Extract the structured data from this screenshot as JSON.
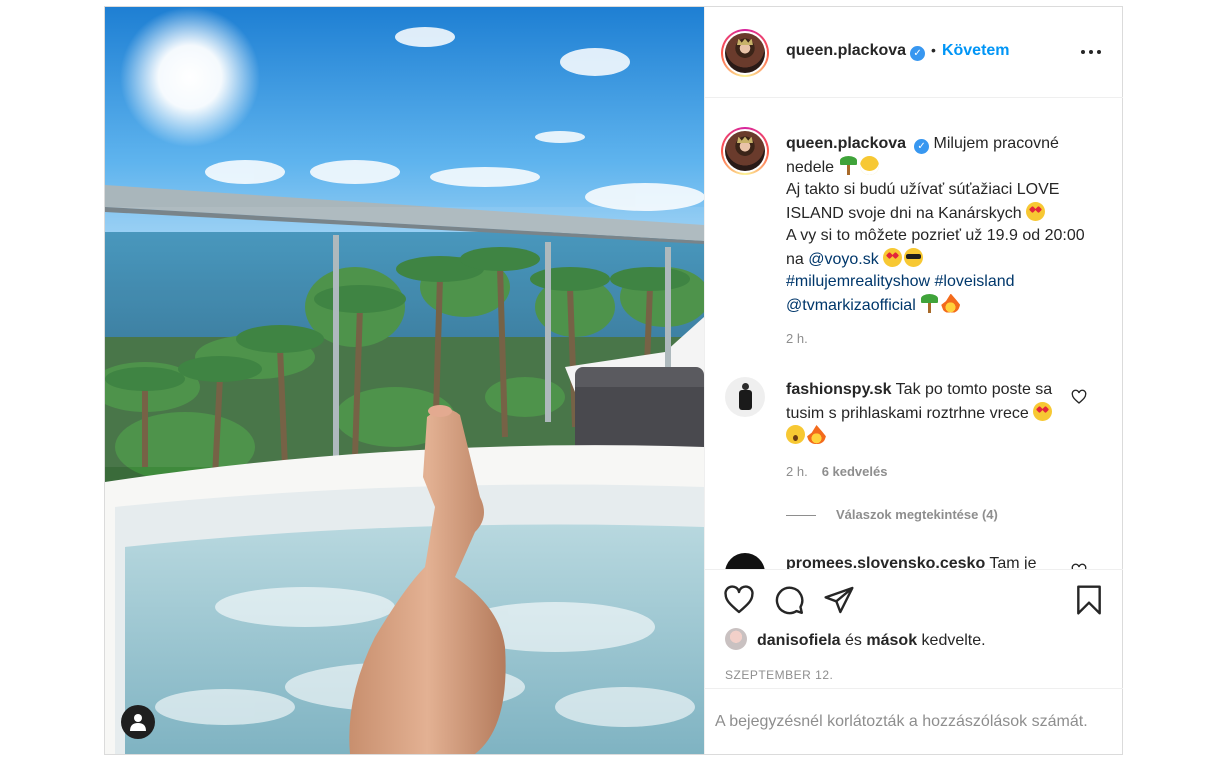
{
  "post": {
    "username": "queen.plackova",
    "verified_icon": "verified-badge-icon",
    "separator": "•",
    "follow_label": "Követem",
    "more_icon": "more-options-icon",
    "photo_description_icon": "user-tag-icon"
  },
  "caption": {
    "username": "queen.plackova",
    "line1": "Milujem pracovné nedele",
    "line2": "Aj takto si budú užívať súťažiaci LOVE ISLAND svoje dni na Kanárskych",
    "line3": "A vy si to môžete pozrieť už 19.9 od 20:00 na",
    "mention_voyo": "@voyo.sk",
    "hashtags": "#milujemrealityshow #loveisland",
    "mention_markiza": "@tvmarkizaofficial",
    "time": "2 h."
  },
  "comments": [
    {
      "username": "fashionspy.sk",
      "text": "Tak po tomto poste sa tusim s prihlaskami roztrhne vrece",
      "time": "2 h.",
      "likes": "6 kedvelés",
      "replies": "Válaszok megtekintése (4)"
    },
    {
      "username": "promees.slovensko.cesko",
      "text": "Tam je"
    }
  ],
  "actions": {
    "like_icon": "heart-icon",
    "comment_icon": "comment-icon",
    "share_icon": "share-icon",
    "save_icon": "bookmark-icon"
  },
  "likes": {
    "user": "danisofiela",
    "conj": "és",
    "others": "mások",
    "suffix": "kedvelte."
  },
  "date": "SZEPTEMBER 12.",
  "comments_disabled": "A bejegyzésnél korlátozták a hozzászólások számát.",
  "colors": {
    "accent": "#0095f6",
    "verified": "#3897f0",
    "muted": "#8e8e8e",
    "text": "#262626"
  }
}
